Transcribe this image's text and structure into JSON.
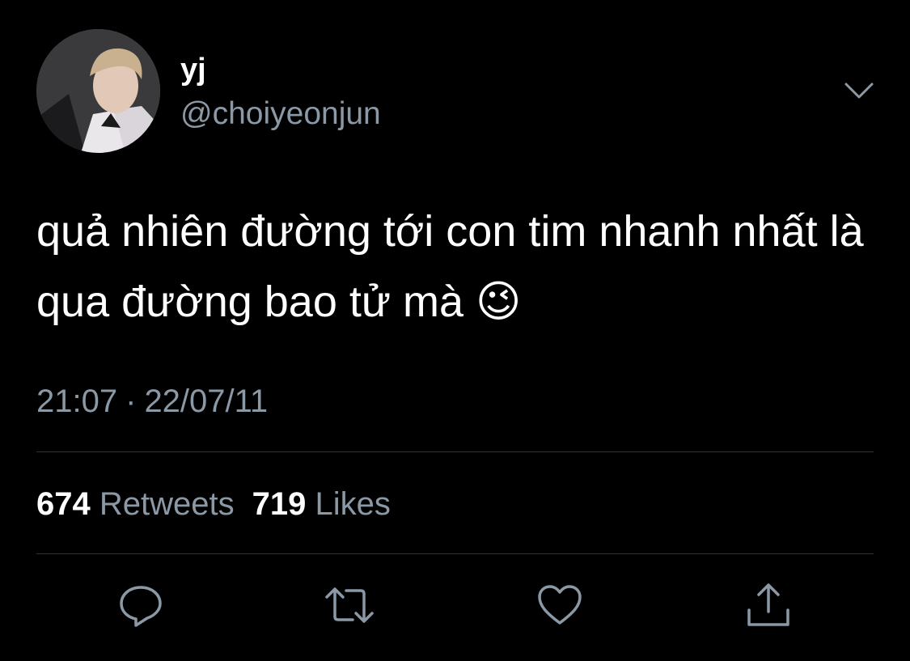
{
  "tweet": {
    "display_name": "yj",
    "handle": "@choiyeonjun",
    "text": "quả nhiên đường tới con tim nhanh nhất là qua đường bao tử mà 😉",
    "time": "21:07",
    "separator": "·",
    "date": "22/07/11"
  },
  "stats": {
    "retweets_count": "674",
    "retweets_label": "Retweets",
    "likes_count": "719",
    "likes_label": "Likes"
  },
  "icons": {
    "more": "chevron-down-icon",
    "reply": "reply-icon",
    "retweet": "retweet-icon",
    "like": "heart-icon",
    "share": "share-icon"
  },
  "colors": {
    "background": "#000000",
    "text_primary": "#ffffff",
    "text_secondary": "#8b98a5",
    "divider": "#2f3336"
  }
}
